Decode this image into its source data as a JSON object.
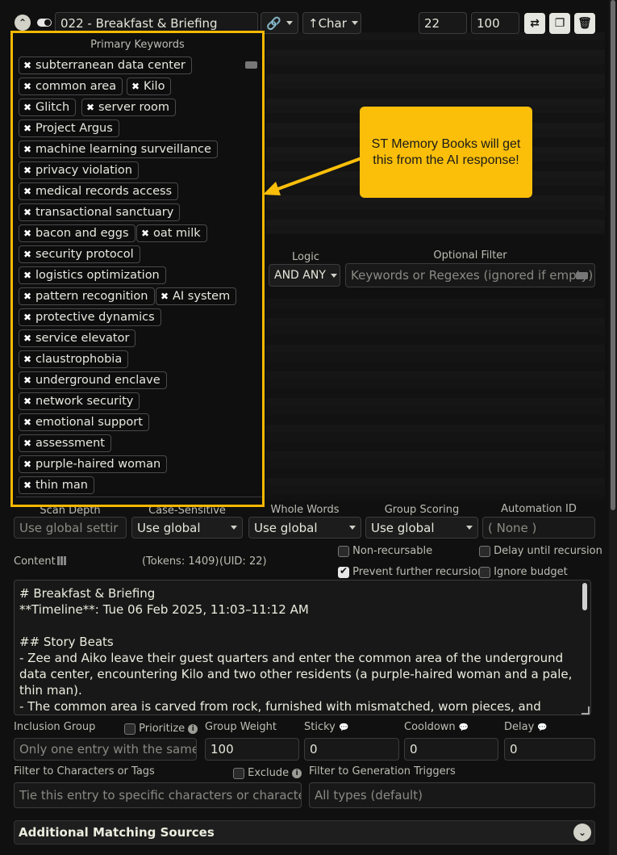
{
  "header": {
    "entry_title": "022 - Breakfast & Briefing",
    "strategy_label": "↑Char",
    "order_value": "22",
    "probability_value": "100"
  },
  "keywords": {
    "label": "Primary Keywords",
    "tags": [
      "subterranean data center",
      "common area",
      "Kilo",
      "Glitch",
      "server room",
      "Project Argus",
      "machine learning surveillance",
      "privacy violation",
      "medical records access",
      "transactional sanctuary",
      "bacon and eggs",
      "oat milk",
      "security protocol",
      "logistics optimization",
      "pattern recognition",
      "AI system",
      "protective dynamics",
      "service elevator",
      "claustrophobia",
      "underground enclave",
      "network security",
      "emotional support",
      "assessment",
      "purple-haired woman",
      "thin man"
    ]
  },
  "callout": {
    "text": "ST Memory Books will get this from the AI response!"
  },
  "logic": {
    "label": "Logic",
    "value": "AND ANY"
  },
  "optional_filter": {
    "label": "Optional Filter",
    "placeholder": "Keywords or Regexes (ignored if empty)"
  },
  "row2": {
    "scan_depth_label": "Scan Depth",
    "scan_depth_placeholder": "Use global settir",
    "case_sensitive_label": "Case-Sensitive",
    "case_sensitive_value": "Use global",
    "whole_words_label": "Whole Words",
    "whole_words_value": "Use global",
    "group_scoring_label": "Group Scoring",
    "group_scoring_value": "Use global",
    "automation_id_label": "Automation ID",
    "automation_id_placeholder": "( None )"
  },
  "content": {
    "label": "Content",
    "tokens": "(Tokens:  1409)",
    "uid": "(UID: 22)",
    "text": "# Breakfast & Briefing\n**Timeline**: Tue 06 Feb 2025, 11:03–11:12 AM\n\n## Story Beats\n- Zee and Aiko leave their guest quarters and enter the common area of the underground data center, encountering Kilo and two other residents (a purple-haired woman and a pale, thin man).\n- The common area is carved from rock, furnished with mismatched, worn pieces, and features a functioning kitchenette with the smell of real bacon, eggs, and coffee."
  },
  "checkboxes": {
    "non_recursable": "Non-recursable",
    "delay_until_recursion": "Delay until recursion",
    "prevent_further_recursion": "Prevent further recursion",
    "ignore_budget": "Ignore budget"
  },
  "row3": {
    "inclusion_group_label": "Inclusion Group",
    "prioritize_label": "Prioritize",
    "inclusion_group_placeholder": "Only one entry with the same l",
    "group_weight_label": "Group Weight",
    "group_weight_value": "100",
    "sticky_label": "Sticky",
    "sticky_value": "0",
    "cooldown_label": "Cooldown",
    "cooldown_value": "0",
    "delay_label": "Delay",
    "delay_value": "0"
  },
  "row4": {
    "filter_chars_label": "Filter to Characters or Tags",
    "exclude_label": "Exclude",
    "filter_chars_placeholder": "Tie this entry to specific characters or characters",
    "filter_triggers_label": "Filter to Generation Triggers",
    "filter_triggers_placeholder": "All types (default)"
  },
  "accordion": {
    "title": "Additional Matching Sources"
  }
}
